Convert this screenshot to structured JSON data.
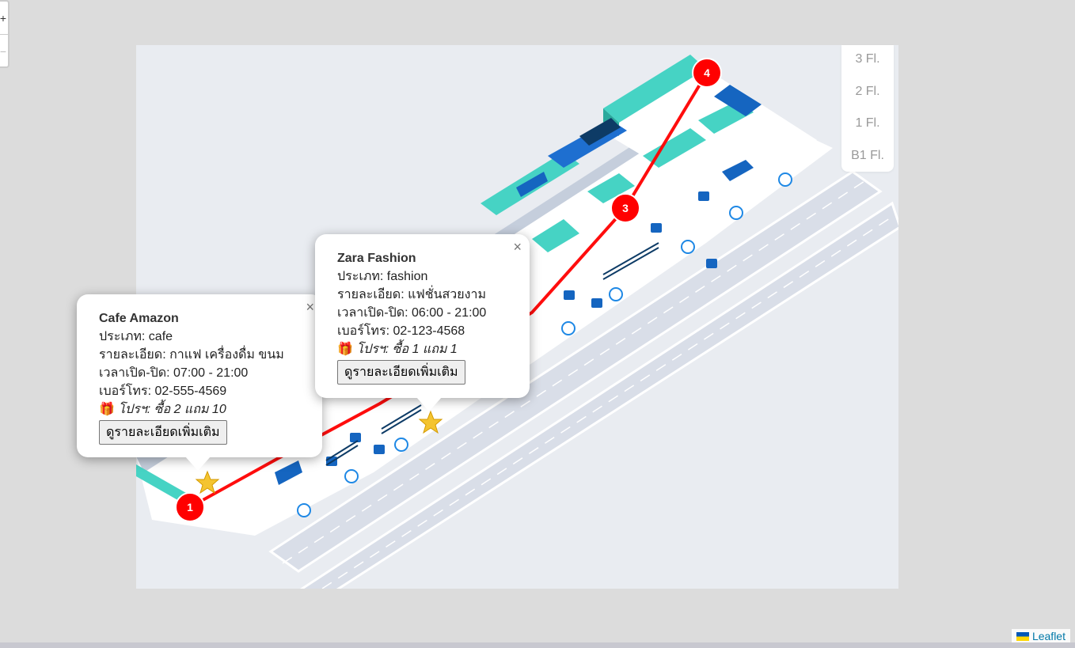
{
  "floors": [
    "3 Fl.",
    "2 Fl.",
    "1 Fl.",
    "B1 Fl."
  ],
  "route": {
    "color": "#ff0000",
    "markers": [
      {
        "label": "1"
      },
      {
        "label": "3"
      },
      {
        "label": "4"
      }
    ]
  },
  "popups": [
    {
      "title": "Cafe Amazon",
      "type_line": "ประเภท: cafe",
      "detail_line": "รายละเอียด: กาแฟ เครื่องดื่ม ขนม",
      "hours_line": "เวลาเปิด-ปิด: 07:00 - 21:00",
      "phone_line": "เบอร์โทร: 02-555-4569",
      "promo_line": "โปรฯ: ซื้อ 2 แถม 10",
      "button_label": "ดูรายละเอียดเพิ่มเติม",
      "close_label": "×"
    },
    {
      "title": "Zara Fashion",
      "type_line": "ประเภท: fashion",
      "detail_line": "รายละเอียด: แฟชั่นสวยงาม",
      "hours_line": "เวลาเปิด-ปิด: 06:00 - 21:00",
      "phone_line": "เบอร์โทร: 02-123-4568",
      "promo_line": "โปรฯ: ซื้อ 1 แถม 1",
      "button_label": "ดูรายละเอียดเพิ่มเติม",
      "close_label": "×"
    }
  ],
  "zoom": {
    "in_label": "+",
    "out_label": "−"
  },
  "attribution": "Leaflet",
  "colors": {
    "teal": "#46d3c4",
    "blue": "#1565c0",
    "navy": "#0d3b66",
    "route": "#ff0000",
    "star": "#f4c430"
  },
  "icons": [
    "gift-icon",
    "star-icon",
    "close-icon",
    "flag-icon"
  ]
}
